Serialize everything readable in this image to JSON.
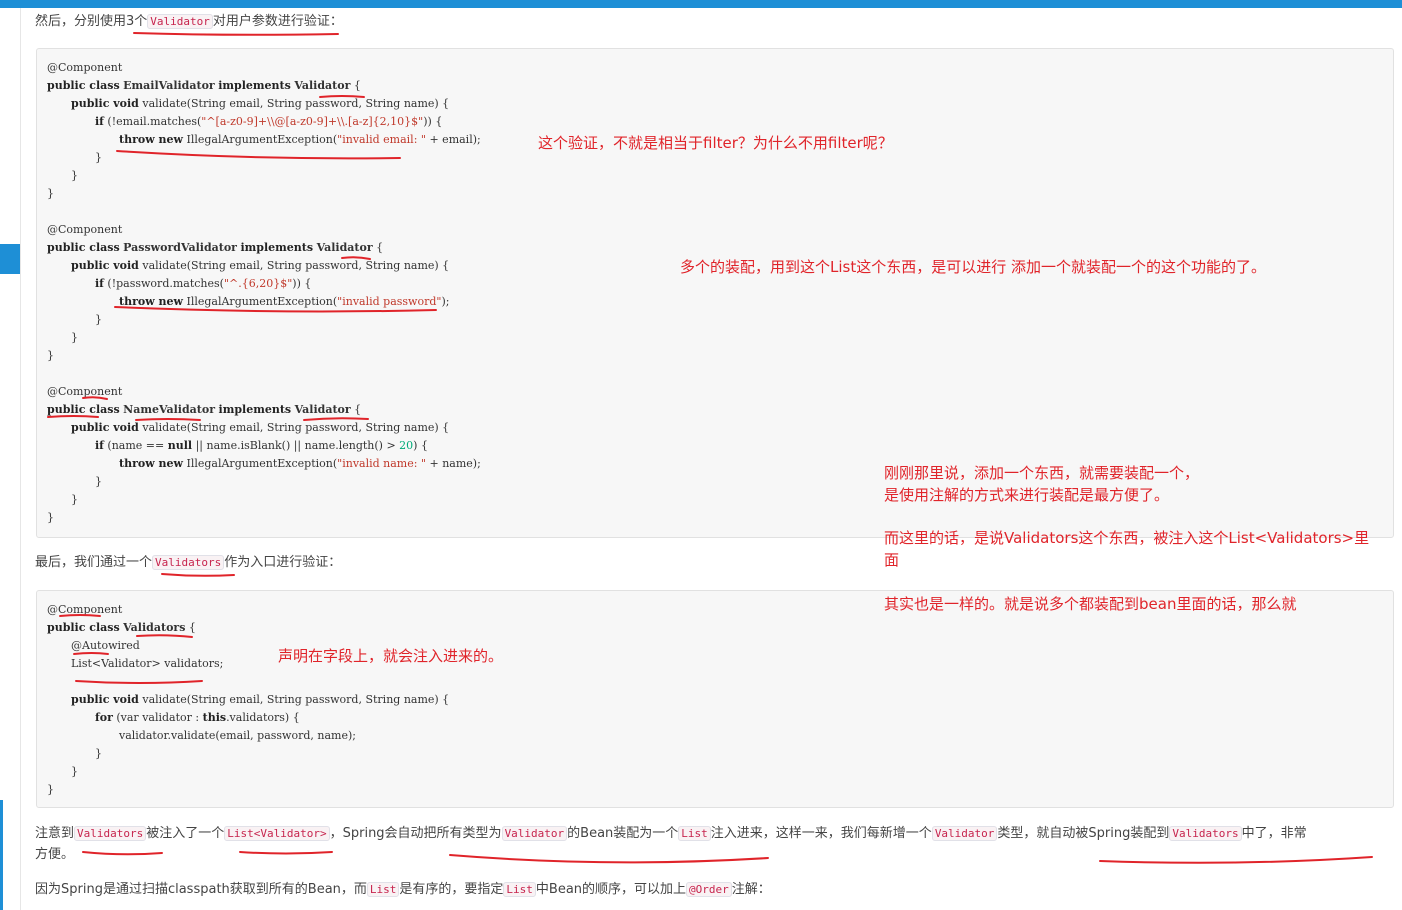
{
  "paragraphs": {
    "p1": {
      "pre": "然后，分别使用3个",
      "code": "Validator",
      "post": "对用户参数进行验证："
    },
    "p2": {
      "pre": "最后，我们通过一个",
      "code": "Validators",
      "post": "作为入口进行验证："
    },
    "p3": {
      "t1": "注意到",
      "c1": "Validators",
      "t2": "被注入了一个",
      "c2": "List<Validator>",
      "t3": "，Spring会自动把所有类型为",
      "c3": "Validator",
      "t4": "的Bean装配为一个",
      "c4": "List",
      "t5": "注入进来，这样一来，我们每新增一个",
      "c5": "Validator",
      "t6": "类型，就自动被Spring装配到",
      "c6": "Validators",
      "t7": "中了，非常",
      "t8": "方便。"
    },
    "p4": {
      "t1": "因为Spring是通过扫描classpath获取到所有的Bean，而",
      "c1": "List",
      "t2": "是有序的，要指定",
      "c2": "List",
      "t3": "中Bean的顺序，可以加上",
      "c3": "@Order",
      "t4": "注解："
    }
  },
  "code1": {
    "l1": "@Component",
    "l2": {
      "kw1": "public class",
      "cls": "EmailValidator",
      "kw2": "implements",
      "iface": "Validator",
      "tail": " {"
    },
    "l3": {
      "kw": "public void",
      "rest": " validate(String email, String password, String name) {"
    },
    "l4": {
      "kw": "if",
      "pre": " (!email.matches(",
      "str": "\"^[a-z0-9]+\\\\@[a-z0-9]+\\\\.[a-z]{2,10}$\"",
      "post": ")) {"
    },
    "l5": {
      "kw": "throw new",
      "pre": " IllegalArgumentException(",
      "str": "\"invalid email: \"",
      "post": " + email);"
    },
    "l6": "}",
    "l7": "}",
    "l8": "}"
  },
  "code2": {
    "l1": "@Component",
    "l2": {
      "kw1": "public class",
      "cls": "PasswordValidator",
      "kw2": "implements",
      "iface": "Validator",
      "tail": " {"
    },
    "l3": {
      "kw": "public void",
      "rest": " validate(String email, String password, String name) {"
    },
    "l4": {
      "kw": "if",
      "pre": " (!password.matches(",
      "str": "\"^.{6,20}$\"",
      "post": ")) {"
    },
    "l5": {
      "kw": "throw new",
      "pre": " IllegalArgumentException(",
      "str": "\"invalid password\"",
      "post": ");"
    },
    "l6": "}",
    "l7": "}",
    "l8": "}"
  },
  "code3": {
    "l1": "@Component",
    "l2": {
      "kw1": "public class",
      "cls": "NameValidator",
      "kw2": "implements",
      "iface": "Validator",
      "tail": " {"
    },
    "l3": {
      "kw": "public void",
      "rest": " validate(String email, String password, String name) {"
    },
    "l4": {
      "kw": "if",
      "pre": " (name == ",
      "kw2": "null",
      "mid": " || name.isBlank() || name.length() > ",
      "num": "20",
      "post": ") {"
    },
    "l5": {
      "kw": "throw new",
      "pre": " IllegalArgumentException(",
      "str": "\"invalid name: \"",
      "post": " + name);"
    },
    "l6": "}",
    "l7": "}",
    "l8": "}"
  },
  "code4": {
    "l1": "@Component",
    "l2": {
      "kw1": "public class",
      "cls": "Validators",
      "tail": " {"
    },
    "l3": "@Autowired",
    "l4": "List<Validator> validators;",
    "l5": {
      "kw": "public void",
      "rest": " validate(String email, String password, String name) {"
    },
    "l6": {
      "kw": "for",
      "pre": " (var validator : ",
      "kw2": "this",
      "post": ".validators) {"
    },
    "l7": "validator.validate(email, password, name);",
    "l8": "}",
    "l9": "}",
    "l10": "}"
  },
  "notes": {
    "n1": "这个验证，不就是相当于filter？为什么不用filter呢？",
    "n2": "多个的装配，用到这个List这个东西，是可以进行  添加一个就装配一个的这个功能的了。",
    "n3a": "刚刚那里说，添加一个东西，就需要装配一个，",
    "n3b": "是使用注解的方式来进行装配是最方便了。",
    "n4a": "而这里的话，是说Validators这个东西，被注入这个List<Validators>里",
    "n4b": "面",
    "n5": "其实也是一样的。就是说多个都装配到bean里面的话，那么就",
    "n6": "声明在字段上，就会注入进来的。"
  },
  "colors": {
    "accent": "#1e8fd6",
    "annotation": "#e0242a",
    "code_bg": "#f7f7f7"
  }
}
